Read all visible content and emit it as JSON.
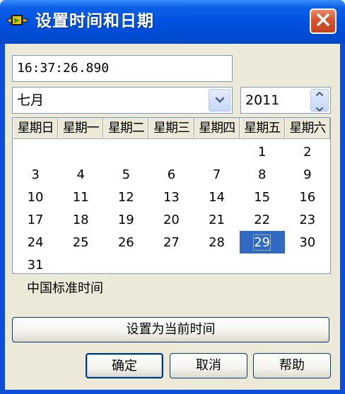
{
  "window": {
    "title": "设置时间和日期",
    "icon": "app-icon",
    "close_icon": "close-icon"
  },
  "time": {
    "value": "16:37:26.890"
  },
  "month_select": {
    "selected": "七月",
    "icon": "chevron-down-icon"
  },
  "year_spinner": {
    "value": "2011",
    "icon": "spin-arrows-icon"
  },
  "calendar": {
    "weekdays": [
      "星期日",
      "星期一",
      "星期二",
      "星期三",
      "星期四",
      "星期五",
      "星期六"
    ],
    "weeks": [
      [
        "",
        "",
        "",
        "",
        "",
        "1",
        "2"
      ],
      [
        "3",
        "4",
        "5",
        "6",
        "7",
        "8",
        "9"
      ],
      [
        "10",
        "11",
        "12",
        "13",
        "14",
        "15",
        "16"
      ],
      [
        "17",
        "18",
        "19",
        "20",
        "21",
        "22",
        "23"
      ],
      [
        "24",
        "25",
        "26",
        "27",
        "28",
        "29",
        "30"
      ],
      [
        "31",
        "",
        "",
        "",
        "",
        "",
        ""
      ]
    ],
    "selected_day": "29",
    "selected_color": "#316ac5"
  },
  "timezone": "中国标准时间",
  "buttons": {
    "set_current": "设置为当前时间",
    "ok": "确定",
    "cancel": "取消",
    "help": "帮助"
  },
  "colors": {
    "titlebar": "#0050df",
    "dialog_background": "#ece9d8",
    "close_button": "#d8532e"
  }
}
